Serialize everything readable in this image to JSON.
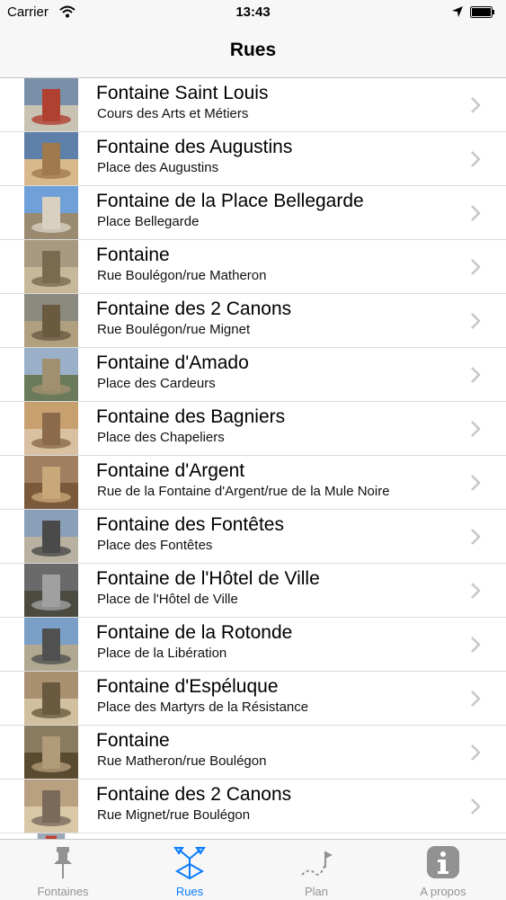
{
  "status_bar": {
    "carrier": "Carrier",
    "time": "13:43"
  },
  "navbar": {
    "title": "Rues"
  },
  "list": {
    "items": [
      {
        "title": "Fontaine Saint Louis",
        "subtitle": "Cours des Arts et Métiers"
      },
      {
        "title": "Fontaine des Augustins",
        "subtitle": "Place des Augustins"
      },
      {
        "title": "Fontaine de la Place Bellegarde",
        "subtitle": "Place Bellegarde"
      },
      {
        "title": "Fontaine",
        "subtitle": "Rue Boulégon/rue Matheron"
      },
      {
        "title": "Fontaine des 2 Canons",
        "subtitle": "Rue Boulégon/rue Mignet"
      },
      {
        "title": "Fontaine d'Amado",
        "subtitle": "Place des Cardeurs"
      },
      {
        "title": "Fontaine des Bagniers",
        "subtitle": "Place des Chapeliers"
      },
      {
        "title": "Fontaine d'Argent",
        "subtitle": "Rue de la Fontaine d'Argent/rue de la Mule Noire"
      },
      {
        "title": "Fontaine des Fontêtes",
        "subtitle": "Place des Fontêtes"
      },
      {
        "title": "Fontaine de l'Hôtel de Ville",
        "subtitle": "Place de l'Hôtel de Ville"
      },
      {
        "title": "Fontaine de la Rotonde",
        "subtitle": "Place de la Libération"
      },
      {
        "title": "Fontaine d'Espéluque",
        "subtitle": "Place des Martyrs de la Résistance"
      },
      {
        "title": "Fontaine",
        "subtitle": "Rue Matheron/rue Boulégon"
      },
      {
        "title": "Fontaine des 2 Canons",
        "subtitle": "Rue Mignet/rue Boulégon"
      }
    ]
  },
  "tabbar": {
    "tabs": [
      {
        "label": "Fontaines",
        "icon": "pushpin-icon",
        "active": false
      },
      {
        "label": "Rues",
        "icon": "directions-icon",
        "active": true
      },
      {
        "label": "Plan",
        "icon": "route-flag-icon",
        "active": false
      },
      {
        "label": "A propos",
        "icon": "info-icon",
        "active": false
      }
    ]
  },
  "colors": {
    "accent": "#0a7bff",
    "inactive": "#929292",
    "bar_background": "#f7f7f7"
  }
}
